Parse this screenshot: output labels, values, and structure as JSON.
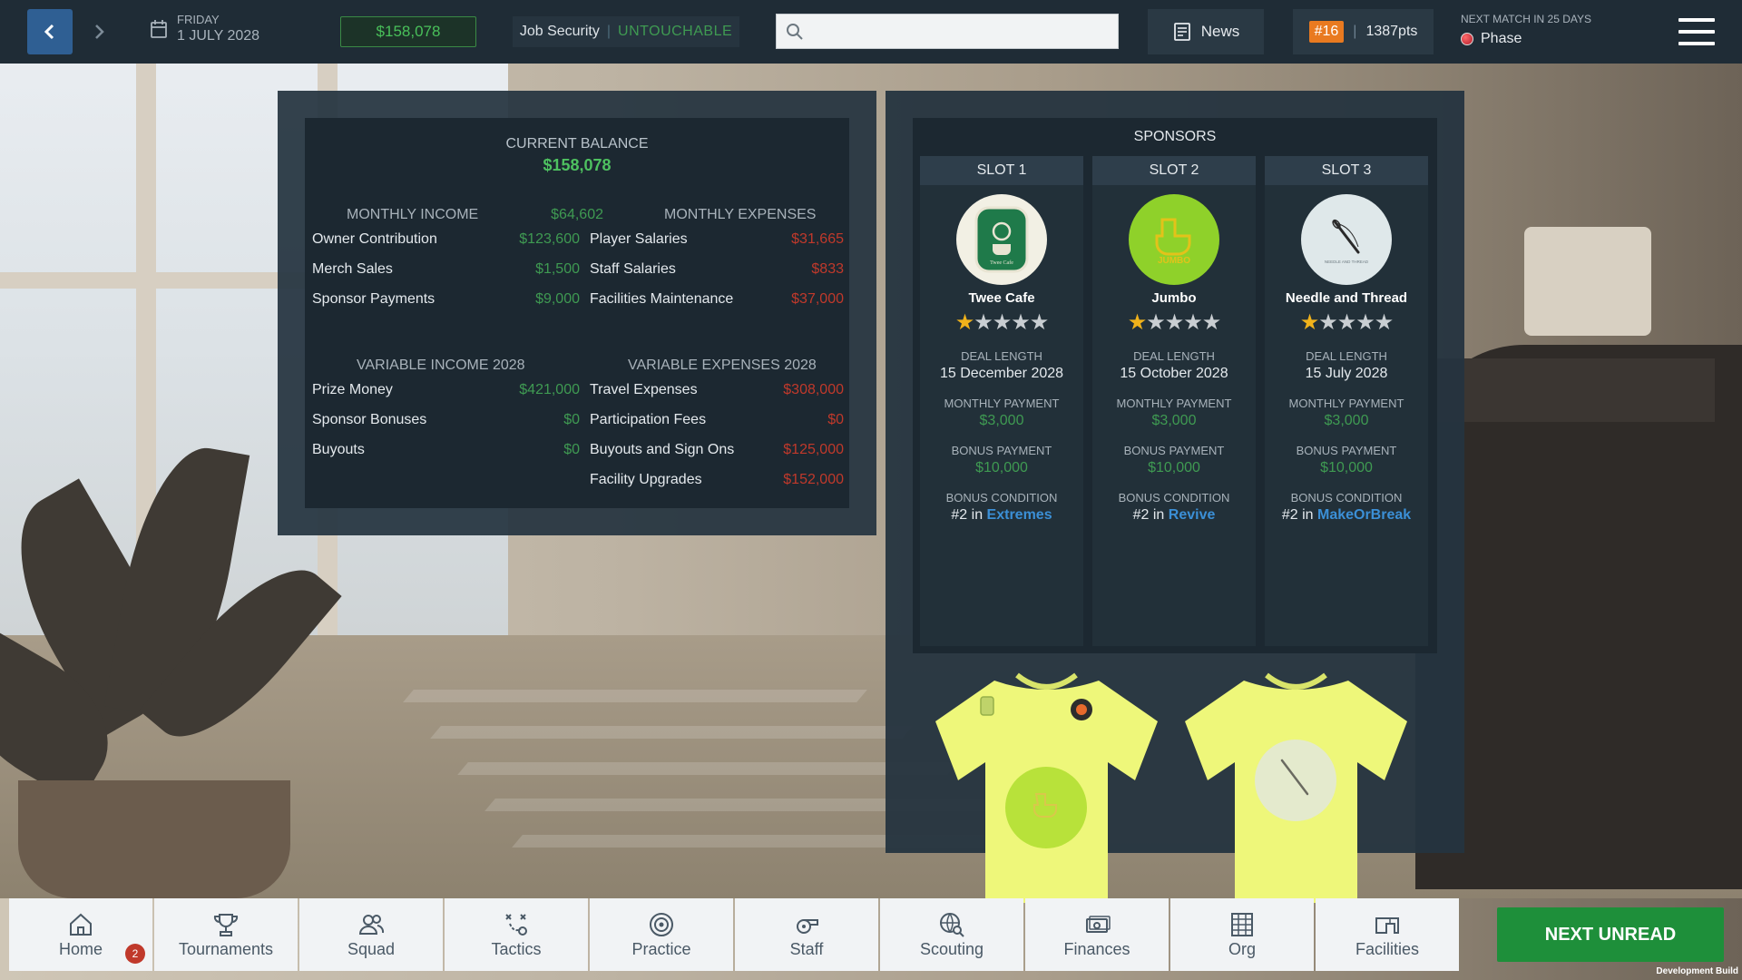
{
  "header": {
    "day_of_week": "FRIDAY",
    "date": "1 JULY 2028",
    "balance": "$158,078",
    "job_security_label": "Job Security",
    "job_security_value": "UNTOUCHABLE",
    "search_placeholder": "",
    "news_label": "News",
    "rank": "#16",
    "points": "1387pts",
    "next_match_label": "NEXT MATCH IN 25 DAYS",
    "next_match_team": "Phase"
  },
  "finances": {
    "current_balance_label": "CURRENT BALANCE",
    "current_balance": "$158,078",
    "monthly_income_label": "MONTHLY INCOME",
    "monthly_income_total": "$64,602",
    "monthly_expenses_label": "MONTHLY EXPENSES",
    "monthly_income": [
      {
        "name": "Owner Contribution",
        "value": "$123,600"
      },
      {
        "name": "Merch Sales",
        "value": "$1,500"
      },
      {
        "name": "Sponsor Payments",
        "value": "$9,000"
      }
    ],
    "monthly_expenses": [
      {
        "name": "Player Salaries",
        "value": "$31,665"
      },
      {
        "name": "Staff Salaries",
        "value": "$833"
      },
      {
        "name": "Facilities Maintenance",
        "value": "$37,000"
      }
    ],
    "variable_income_label": "VARIABLE INCOME 2028",
    "variable_expenses_label": "VARIABLE EXPENSES 2028",
    "variable_income": [
      {
        "name": "Prize Money",
        "value": "$421,000"
      },
      {
        "name": "Sponsor Bonuses",
        "value": "$0"
      },
      {
        "name": "Buyouts",
        "value": "$0"
      }
    ],
    "variable_expenses": [
      {
        "name": "Travel Expenses",
        "value": "$308,000"
      },
      {
        "name": "Participation Fees",
        "value": "$0"
      },
      {
        "name": "Buyouts and Sign Ons",
        "value": "$125,000"
      },
      {
        "name": "Facility Upgrades",
        "value": "$152,000"
      }
    ]
  },
  "sponsors": {
    "title": "SPONSORS",
    "deal_length_label": "DEAL LENGTH",
    "monthly_payment_label": "MONTHLY PAYMENT",
    "bonus_payment_label": "BONUS PAYMENT",
    "bonus_condition_label": "BONUS CONDITION",
    "slots": [
      {
        "slot": "SLOT 1",
        "name": "Twee Cafe",
        "logo_text": "Twee Cafe",
        "stars": 1,
        "deal_length": "15 December 2028",
        "monthly_payment": "$3,000",
        "bonus_payment": "$10,000",
        "cond_prefix": "#2 in",
        "cond_team": "Extremes",
        "logo_bg": "#f2f0e4",
        "logo_fg": "#1f7a4a"
      },
      {
        "slot": "SLOT 2",
        "name": "Jumbo",
        "logo_text": "JUMBO",
        "stars": 1,
        "deal_length": "15 October 2028",
        "monthly_payment": "$3,000",
        "bonus_payment": "$10,000",
        "cond_prefix": "#2 in",
        "cond_team": "Revive",
        "logo_bg": "#8fd12a",
        "logo_fg": "#e3c21a"
      },
      {
        "slot": "SLOT 3",
        "name": "Needle and Thread",
        "logo_text": "NEEDLE AND THREAD",
        "stars": 1,
        "deal_length": "15 July 2028",
        "monthly_payment": "$3,000",
        "bonus_payment": "$10,000",
        "cond_prefix": "#2 in",
        "cond_team": "MakeOrBreak",
        "logo_bg": "#dfe8ea",
        "logo_fg": "#2a2a2a"
      }
    ],
    "shirt_color": "#eef77a"
  },
  "bottom_nav": {
    "tabs": [
      {
        "label": "Home",
        "icon": "home-icon"
      },
      {
        "label": "Tournaments",
        "icon": "trophy-icon"
      },
      {
        "label": "Squad",
        "icon": "squad-icon"
      },
      {
        "label": "Tactics",
        "icon": "tactics-icon"
      },
      {
        "label": "Practice",
        "icon": "target-icon"
      },
      {
        "label": "Staff",
        "icon": "whistle-icon"
      },
      {
        "label": "Scouting",
        "icon": "globe-search-icon"
      },
      {
        "label": "Finances",
        "icon": "cash-icon"
      },
      {
        "label": "Org",
        "icon": "building-icon"
      },
      {
        "label": "Facilities",
        "icon": "facility-icon"
      }
    ],
    "home_badge": "2",
    "next_unread": "NEXT UNREAD"
  },
  "footer": {
    "build_label": "Development Build"
  }
}
